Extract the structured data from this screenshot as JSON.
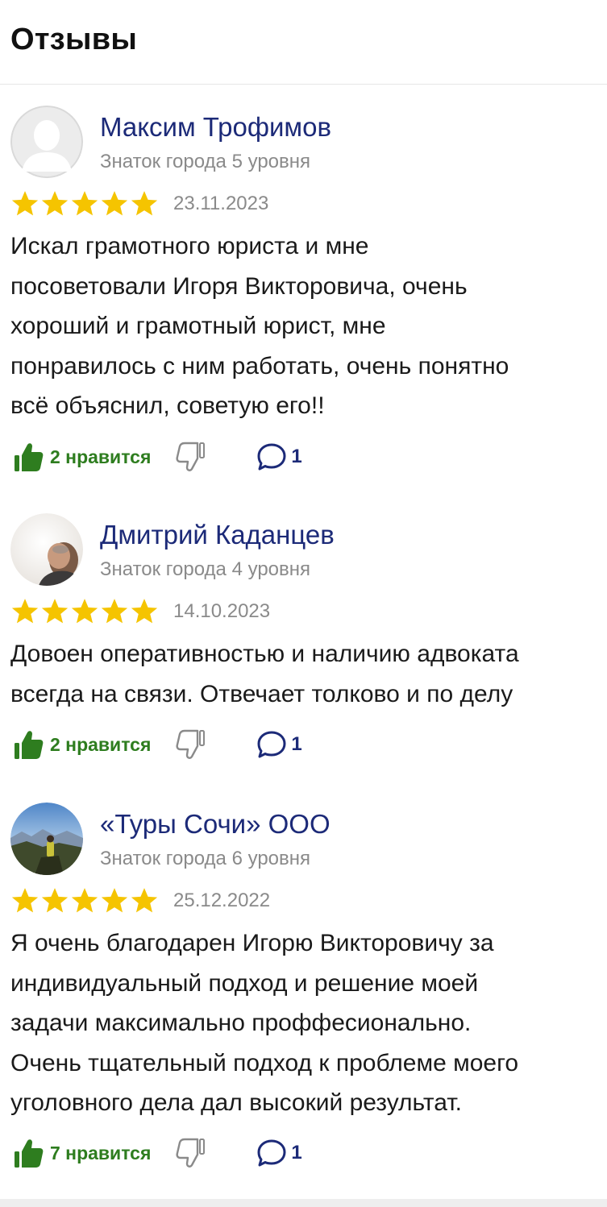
{
  "page": {
    "title": "Отзывы"
  },
  "colors": {
    "name": "#1c2a78",
    "star": "#f5c400",
    "like": "#2e7d1f",
    "muted": "#8a8a8a"
  },
  "reviews": [
    {
      "author": "Максим Трофимов",
      "level": "Знаток города 5 уровня",
      "rating": 5,
      "date": "23.11.2023",
      "text_lines": [
        "Искал грамотного юриста и мне",
        "посоветовали Игоря Викторовича, очень",
        "хороший и грамотный юрист, мне",
        "понравилось с ним работать, очень понятно",
        "всё объяснил, советую его!!"
      ],
      "likes_label": "2 нравится",
      "comments": "1",
      "avatar_icon": "placeholder-person-icon"
    },
    {
      "author": "Дмитрий Каданцев",
      "level": "Знаток города 4 уровня",
      "rating": 5,
      "date": "14.10.2023",
      "text_lines": [
        "Довоен оперативностью и наличию адвоката",
        "всегда на связи. Отвечает толково и по делу"
      ],
      "likes_label": "2 нравится",
      "comments": "1",
      "avatar_icon": "user-photo"
    },
    {
      "author": "«Туры Сочи» ООО",
      "level": "Знаток города 6 уровня",
      "rating": 5,
      "date": "25.12.2022",
      "text_lines": [
        "Я очень благодарен Игорю Викторовичу за",
        "индивидуальный подход и решение моей",
        "задачи максимально проффесионально.",
        "Очень тщательный подход к проблеме моего",
        "уголовного дела дал высокий результат."
      ],
      "likes_label": "7 нравится",
      "comments": "1",
      "avatar_icon": "mountain-photo"
    }
  ]
}
